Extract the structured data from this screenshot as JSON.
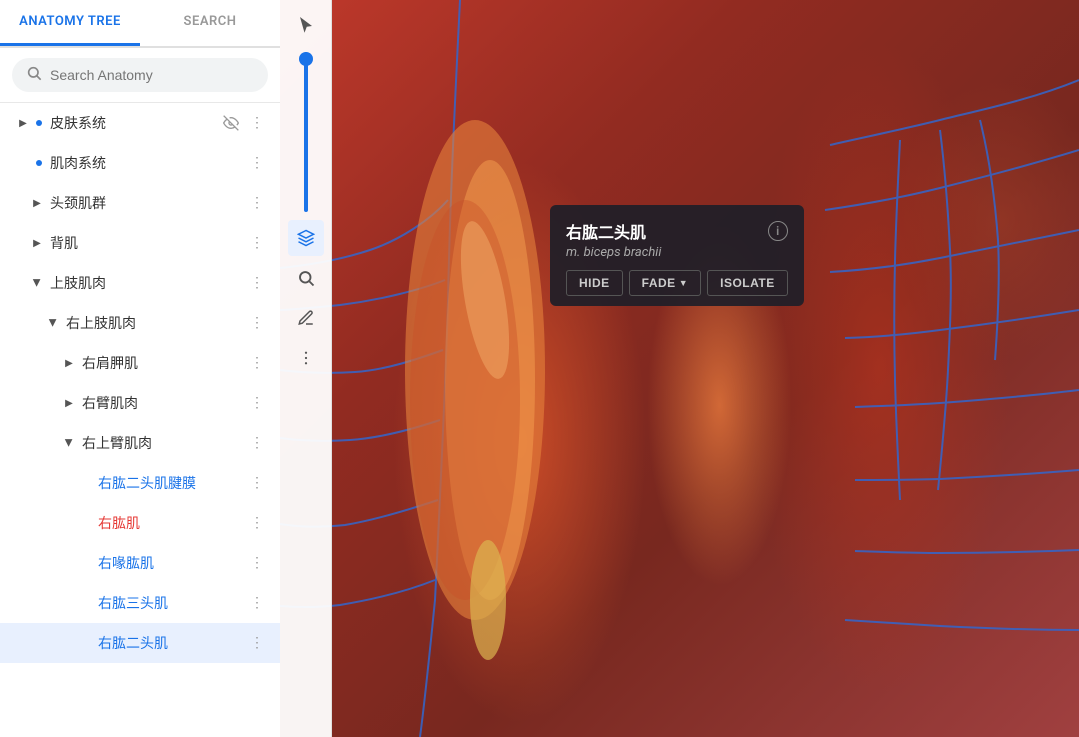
{
  "tabs": [
    {
      "id": "anatomy-tree",
      "label": "ANATOMY TREE",
      "active": true
    },
    {
      "id": "search",
      "label": "SEARCH",
      "active": false
    }
  ],
  "search": {
    "placeholder": "Search Anatomy"
  },
  "toolbar": {
    "cursor_label": "cursor",
    "layers_label": "layers",
    "search_label": "search",
    "pencil_label": "pencil",
    "more_label": "more"
  },
  "tree": {
    "items": [
      {
        "id": "skin-system",
        "label": "皮肤系统",
        "level": 0,
        "expanded": false,
        "has_arrow": true,
        "has_dot": true,
        "has_visibility": true,
        "has_more": true
      },
      {
        "id": "muscle-system",
        "label": "肌肉系统",
        "level": 0,
        "expanded": true,
        "has_arrow": false,
        "has_dot": true,
        "has_more": true
      },
      {
        "id": "head-muscle-group",
        "label": "头颈肌群",
        "level": 1,
        "expanded": false,
        "has_arrow": true,
        "has_more": true
      },
      {
        "id": "back-muscle",
        "label": "背肌",
        "level": 1,
        "expanded": false,
        "has_arrow": true,
        "has_more": true
      },
      {
        "id": "upper-limb-muscle",
        "label": "上肢肌肉",
        "level": 1,
        "expanded": true,
        "has_arrow": true,
        "has_more": true
      },
      {
        "id": "right-upper-arm-muscle",
        "label": "右上肢肌肉",
        "level": 2,
        "expanded": true,
        "has_arrow": true,
        "has_more": true
      },
      {
        "id": "right-shoulder-muscle",
        "label": "右肩胛肌",
        "level": 3,
        "expanded": false,
        "has_arrow": true,
        "has_more": true
      },
      {
        "id": "right-arm-muscle",
        "label": "右臂肌肉",
        "level": 3,
        "expanded": false,
        "has_arrow": true,
        "has_more": true
      },
      {
        "id": "right-upper-arm-muscle2",
        "label": "右上臂肌肉",
        "level": 3,
        "expanded": true,
        "has_arrow": true,
        "has_more": true
      },
      {
        "id": "right-biceps-aponeurosis",
        "label": "右肱二头肌腱膜",
        "level": 4,
        "expanded": false,
        "has_arrow": false,
        "has_more": true,
        "color": "blue"
      },
      {
        "id": "right-coracobrachialis",
        "label": "右肱肌",
        "level": 4,
        "expanded": false,
        "has_arrow": false,
        "has_more": true,
        "color": "red"
      },
      {
        "id": "right-brachialis",
        "label": "右喙肱肌",
        "level": 4,
        "expanded": false,
        "has_arrow": false,
        "has_more": true,
        "color": "blue"
      },
      {
        "id": "right-triceps",
        "label": "右肱三头肌",
        "level": 4,
        "expanded": false,
        "has_arrow": false,
        "has_more": true,
        "color": "blue"
      },
      {
        "id": "right-biceps",
        "label": "右肱二头肌",
        "level": 4,
        "expanded": false,
        "has_arrow": false,
        "has_more": true,
        "color": "blue",
        "active": true
      }
    ]
  },
  "popup": {
    "title": "右肱二头肌",
    "subtitle": "m. biceps brachii",
    "hide_label": "HIDE",
    "fade_label": "FADE",
    "isolate_label": "ISOLATE",
    "info_icon": "i"
  }
}
